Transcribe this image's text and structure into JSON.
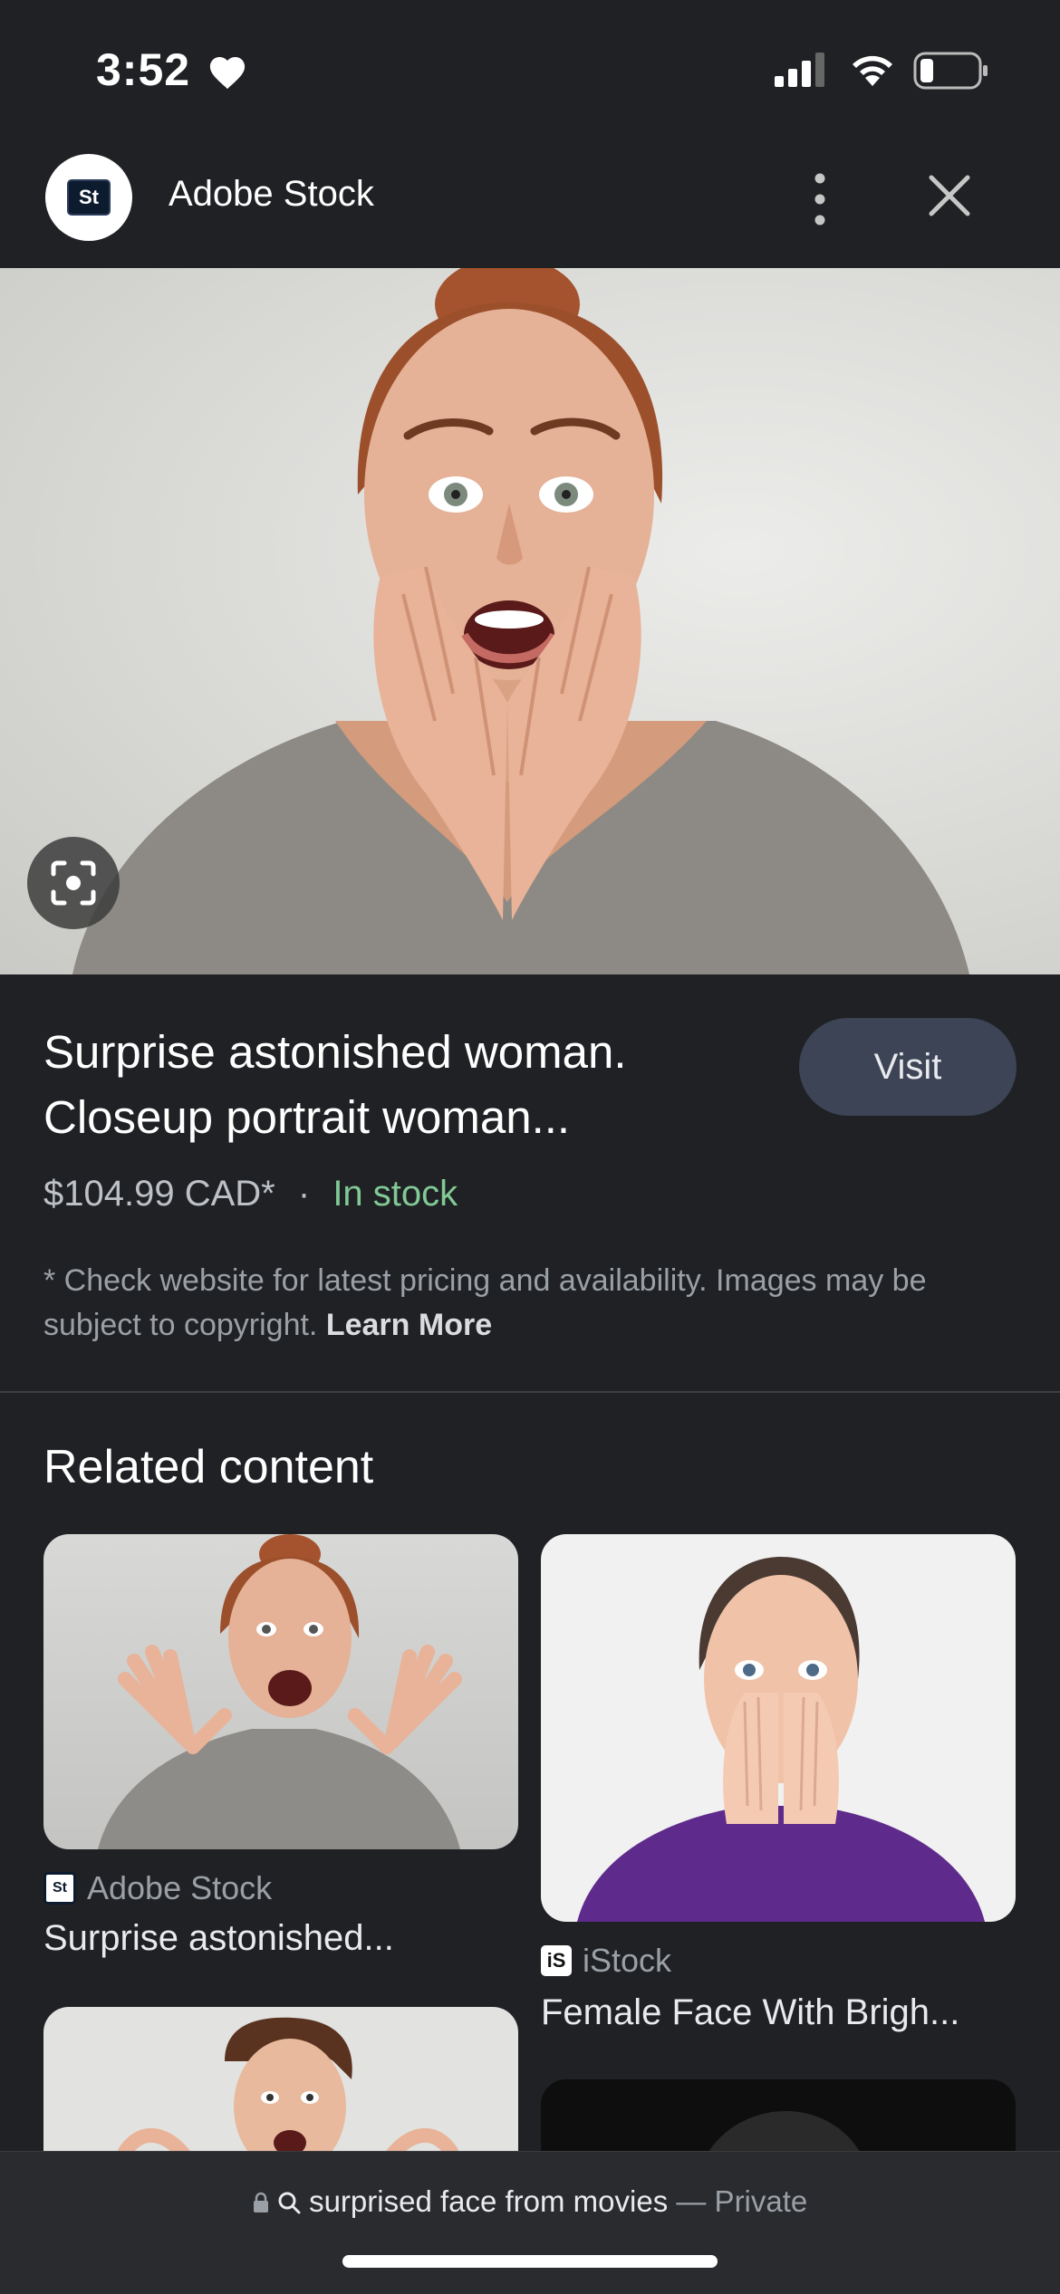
{
  "status_bar": {
    "time": "3:52"
  },
  "header": {
    "site_name": "Adobe Stock",
    "logo_text": "St"
  },
  "product": {
    "title": "Surprise astonished woman. Closeup portrait woman...",
    "price": "$104.99 CAD*",
    "separator": "·",
    "stock": "In stock",
    "disclaimer": "* Check website for latest pricing and availability. Images may be subject to copyright.",
    "learn_more": "Learn More",
    "visit_label": "Visit"
  },
  "related": {
    "heading": "Related content",
    "items": [
      {
        "source": "Adobe Stock",
        "source_icon": "St",
        "title": "Surprise astonished..."
      },
      {
        "source": "iStock",
        "source_icon": "iS",
        "title": "Female Face With Brigh..."
      }
    ]
  },
  "bottom_bar": {
    "query": "surprised face from movies",
    "mode": "— Private"
  },
  "colors": {
    "background": "#202124",
    "accent_green": "#81c995",
    "visit_button": "#3c4456"
  }
}
